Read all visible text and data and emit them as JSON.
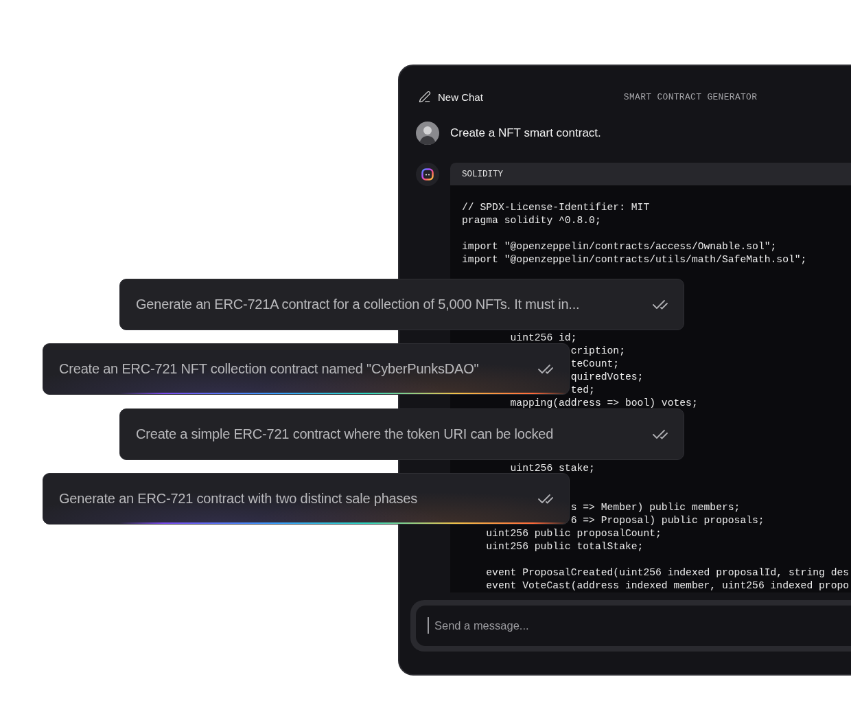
{
  "header": {
    "new_chat": "New Chat",
    "title": "SMART CONTRACT GENERATOR"
  },
  "user_message": {
    "text": "Create a NFT smart contract."
  },
  "reply": {
    "language": "SOLIDITY",
    "code": "// SPDX-License-Identifier: MIT\npragma solidity ^0.8.0;\n\nimport \"@openzeppelin/contracts/access/Ownable.sol\";\nimport \"@openzeppelin/contracts/utils/math/SafeMath.sol\";\n\n\n\n\n\n        uint256 id;\n                  cription;\n                  teCount;\n                  quiredVotes;\n                  ted;\n        mapping(address => bool) votes;\n\n\n\n\n        uint256 stake;\n\n\n                  s => Member) public members;\n                  6 => Proposal) public proposals;\n    uint256 public proposalCount;\n    uint256 public totalStake;\n\n    event ProposalCreated(uint256 indexed proposalId, string des\n    event VoteCast(address indexed member, uint256 indexed propo"
  },
  "suggestions": [
    {
      "text": "Generate an ERC-721A contract for a collection of 5,000 NFTs. It must in...",
      "highlighted": false
    },
    {
      "text": "Create an ERC-721 NFT collection contract named \"CyberPunksDAO\"",
      "highlighted": true
    },
    {
      "text": "Create a simple ERC-721 contract where the token URI can be locked",
      "highlighted": false
    },
    {
      "text": "Generate an ERC-721 contract with two distinct sale phases",
      "highlighted": true
    }
  ],
  "composer": {
    "placeholder": "Send a message..."
  }
}
